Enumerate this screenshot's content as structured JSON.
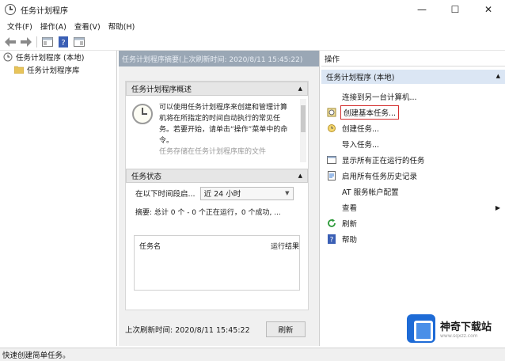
{
  "window": {
    "title": "任务计划程序"
  },
  "window_controls": {
    "minimize": "—",
    "maximize": "☐",
    "close": "✕"
  },
  "menu": [
    "文件(F)",
    "操作(A)",
    "查看(V)",
    "帮助(H)"
  ],
  "tree": {
    "root": "任务计划程序 (本地)",
    "child": "任务计划程序库"
  },
  "middle": {
    "header": "任务计划程序摘要(上次刷新时间: 2020/8/11 15:45:22)",
    "overview_title": "任务计划程序概述",
    "overview_text": "可以使用任务计划程序来创建和管理计算机将在所指定的时间自动执行的常见任务。若要开始，请单击“操作”菜单中的命令。",
    "overview_cut": "任务存储在任务计划程序库的文件",
    "status_title": "任务状态",
    "range_label": "在以下时间段启...",
    "range_value": "近 24 小时",
    "summary": "摘要: 总计 0 个 - 0 个正在运行，0 个成功, ...",
    "table_headers": [
      "任务名",
      "运行结果"
    ],
    "last_refresh": "上次刷新时间: 2020/8/11 15:45:22",
    "refresh_button": "刷新"
  },
  "actions": {
    "title": "操作",
    "group": "任务计划程序 (本地)",
    "items": [
      {
        "label": "连接到另一台计算机...",
        "icon": "computer-icon"
      },
      {
        "label": "创建基本任务...",
        "icon": "create-basic-task-icon",
        "highlighted": true
      },
      {
        "label": "创建任务...",
        "icon": "create-task-icon"
      },
      {
        "label": "导入任务...",
        "icon": ""
      },
      {
        "label": "显示所有正在运行的任务",
        "icon": "running-tasks-icon"
      },
      {
        "label": "启用所有任务历史记录",
        "icon": "history-icon"
      },
      {
        "label": "AT 服务帐户配置",
        "icon": ""
      },
      {
        "label": "查看",
        "icon": "",
        "submenu": true
      },
      {
        "label": "刷新",
        "icon": "refresh-icon"
      },
      {
        "label": "帮助",
        "icon": "help-icon"
      }
    ]
  },
  "statusbar": {
    "text": "快速创建简单任务。"
  },
  "watermark": {
    "title": "神奇下载站",
    "url": "www.sqxzz.com"
  },
  "colors": {
    "header": "#9aa7b5",
    "group": "#dbe6f4",
    "highlight_border": "#d43030",
    "logo": "#1e6bd6"
  }
}
